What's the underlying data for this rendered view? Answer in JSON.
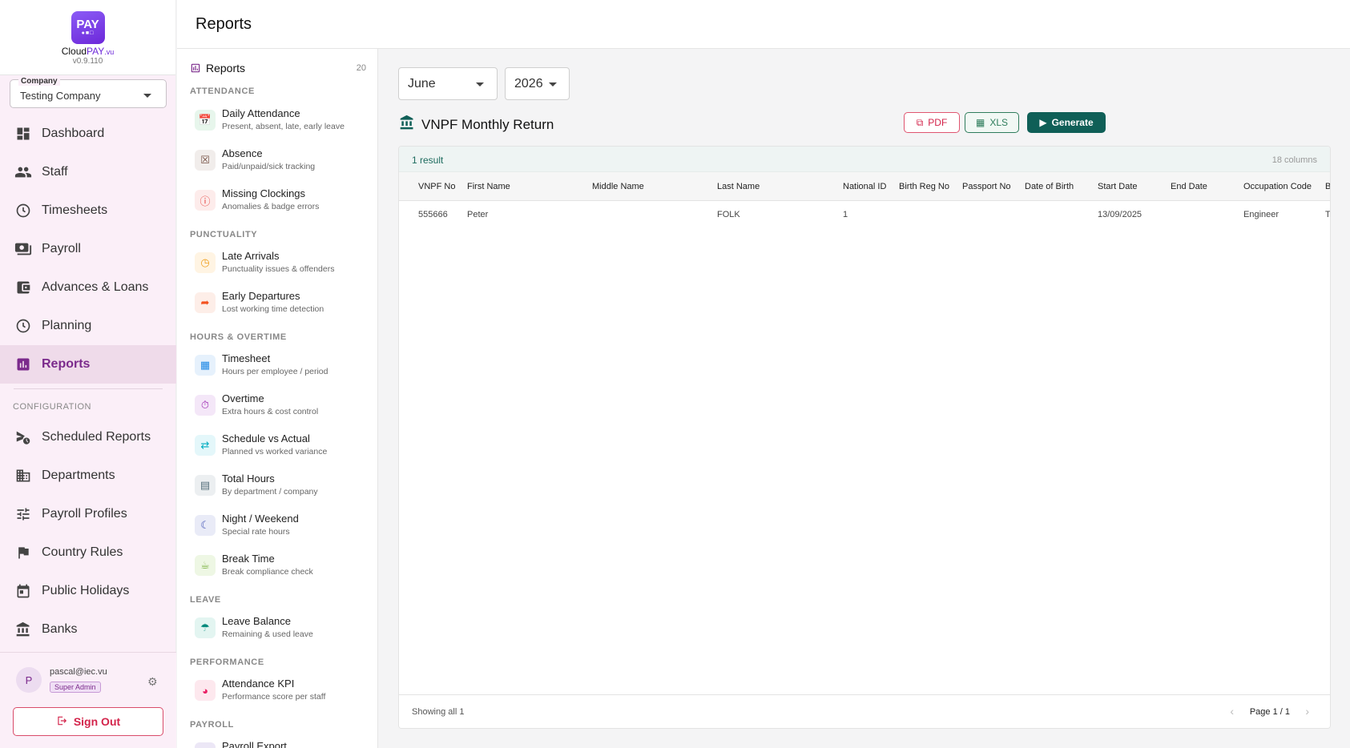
{
  "brand": {
    "logo_text": "PAY",
    "name_pre": "Cloud",
    "name_main": "PAY",
    "name_suffix": ".vu",
    "version": "v0.9.110"
  },
  "company": {
    "label": "Company",
    "value": "Testing Company"
  },
  "nav": {
    "items": [
      {
        "label": "Dashboard",
        "icon": "dashboard-icon"
      },
      {
        "label": "Staff",
        "icon": "people-icon"
      },
      {
        "label": "Timesheets",
        "icon": "clock-icon"
      },
      {
        "label": "Payroll",
        "icon": "payments-icon"
      },
      {
        "label": "Advances & Loans",
        "icon": "wallet-icon"
      },
      {
        "label": "Planning",
        "icon": "clock-icon"
      },
      {
        "label": "Reports",
        "icon": "bar-chart-icon",
        "active": true
      }
    ],
    "config_title": "CONFIGURATION",
    "config_items": [
      {
        "label": "Scheduled Reports",
        "icon": "schedule-send-icon"
      },
      {
        "label": "Departments",
        "icon": "building-icon"
      },
      {
        "label": "Payroll Profiles",
        "icon": "sliders-icon"
      },
      {
        "label": "Country Rules",
        "icon": "flag-icon"
      },
      {
        "label": "Public Holidays",
        "icon": "calendar-icon"
      },
      {
        "label": "Banks",
        "icon": "bank-icon"
      }
    ]
  },
  "user": {
    "initial": "P",
    "email": "pascal@iec.vu",
    "role": "Super Admin",
    "signout": "Sign Out"
  },
  "header": {
    "title": "Reports"
  },
  "reports_panel": {
    "title": "Reports",
    "count": "20",
    "groups": {
      "attendance": "ATTENDANCE",
      "punctuality": "PUNCTUALITY",
      "hours": "HOURS & OVERTIME",
      "leave": "LEAVE",
      "performance": "PERFORMANCE",
      "payroll": "PAYROLL"
    },
    "items": [
      {
        "title": "Daily Attendance",
        "subtitle": "Present, absent, late, early leave"
      },
      {
        "title": "Absence",
        "subtitle": "Paid/unpaid/sick tracking"
      },
      {
        "title": "Missing Clockings",
        "subtitle": "Anomalies & badge errors"
      },
      {
        "title": "Late Arrivals",
        "subtitle": "Punctuality issues & offenders"
      },
      {
        "title": "Early Departures",
        "subtitle": "Lost working time detection"
      },
      {
        "title": "Timesheet",
        "subtitle": "Hours per employee / period"
      },
      {
        "title": "Overtime",
        "subtitle": "Extra hours & cost control"
      },
      {
        "title": "Schedule vs Actual",
        "subtitle": "Planned vs worked variance"
      },
      {
        "title": "Total Hours",
        "subtitle": "By department / company"
      },
      {
        "title": "Night / Weekend",
        "subtitle": "Special rate hours"
      },
      {
        "title": "Break Time",
        "subtitle": "Break compliance check"
      },
      {
        "title": "Leave Balance",
        "subtitle": "Remaining & used leave"
      },
      {
        "title": "Attendance KPI",
        "subtitle": "Performance score per staff"
      },
      {
        "title": "Payroll Export",
        "subtitle": ""
      }
    ]
  },
  "filters": {
    "month": "June",
    "year": "2026"
  },
  "report": {
    "title": "VNPF Monthly Return",
    "pdf": "PDF",
    "xls": "XLS",
    "generate": "Generate"
  },
  "table": {
    "result_count": "1 result",
    "columns_count": "18 columns",
    "headers": [
      "VNPF No",
      "First Name",
      "Middle Name",
      "Last Name",
      "National ID",
      "Birth Reg No",
      "Passport No",
      "Date of Birth",
      "Start Date",
      "End Date",
      "Occupation Code",
      "B"
    ],
    "rows": [
      [
        "555666",
        "Peter",
        "",
        "FOLK",
        "1",
        "",
        "",
        "",
        "13/09/2025",
        "",
        "Engineer",
        "T"
      ]
    ],
    "footer_showing": "Showing all 1",
    "page_label": "Page 1 / 1"
  }
}
